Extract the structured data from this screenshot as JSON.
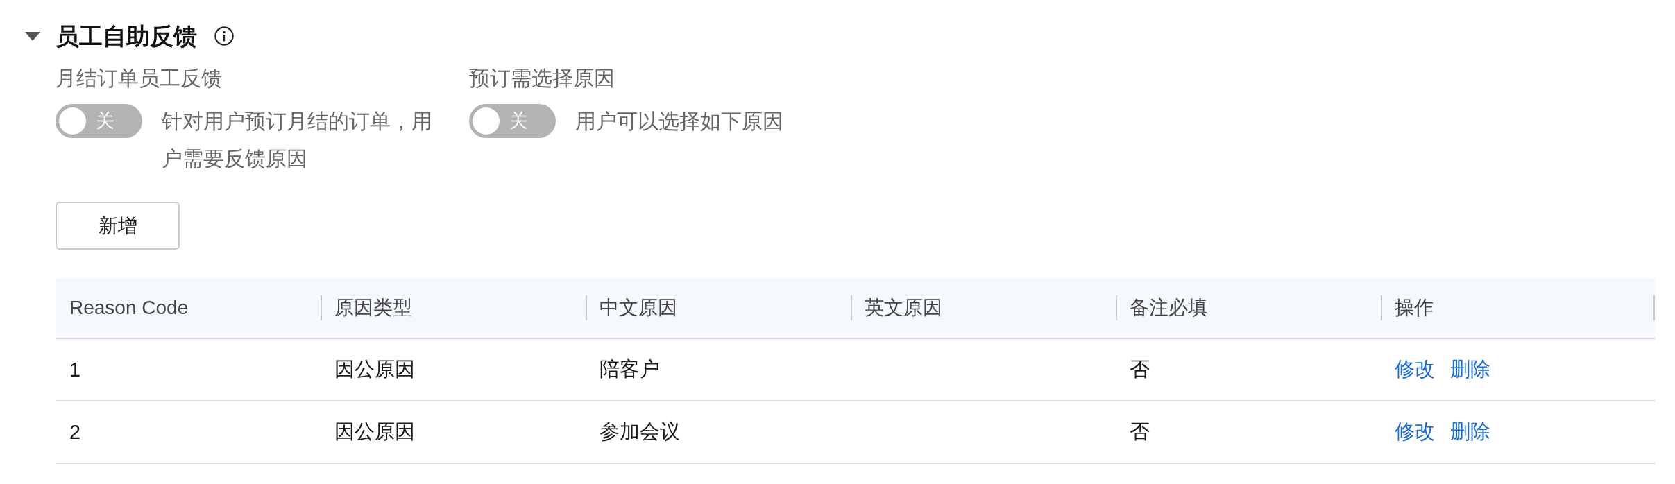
{
  "section": {
    "title": "员工自助反馈",
    "expanded": true
  },
  "settings": [
    {
      "label": "月结订单员工反馈",
      "toggle": {
        "on": false,
        "text": "关"
      },
      "description": "针对用户预订月结的订单，用户需要反馈原因"
    },
    {
      "label": "预订需选择原因",
      "toggle": {
        "on": false,
        "text": "关"
      },
      "description": "用户可以选择如下原因"
    }
  ],
  "add_button": "新增",
  "table": {
    "columns": [
      "Reason Code",
      "原因类型",
      "中文原因",
      "英文原因",
      "备注必填",
      "操作"
    ],
    "rows": [
      {
        "reason_code": "1",
        "reason_type": "因公原因",
        "chinese_reason": "陪客户",
        "remark_required": "否",
        "actions": [
          "修改",
          "删除"
        ]
      },
      {
        "reason_code": "2",
        "reason_type": "因公原因",
        "chinese_reason": "参加会议",
        "remark_required": "否",
        "actions": [
          "修改",
          "删除"
        ]
      }
    ]
  }
}
